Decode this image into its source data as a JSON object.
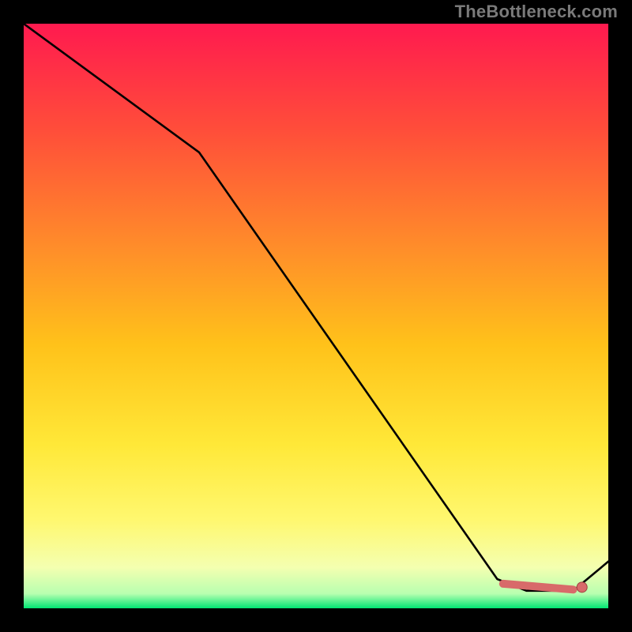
{
  "watermark": "TheBottleneck.com",
  "colors": {
    "black": "#000000",
    "watermark_grey": "#7a7a7a",
    "line": "#000000",
    "dot_fill": "#d86a6a",
    "dot_stroke": "#9e4040",
    "grad_top": "#ff1a4f",
    "grad_mid1": "#ff4d3a",
    "grad_mid2": "#ff8c2a",
    "grad_mid3": "#ffc21a",
    "grad_mid4": "#ffe838",
    "grad_mid5": "#fff870",
    "grad_mid6": "#f4ffb0",
    "grad_mid7": "#b8ffb0",
    "grad_bottom": "#00e673"
  },
  "chart_data": {
    "type": "line",
    "title": "",
    "xlabel": "",
    "ylabel": "",
    "xlim": [
      0,
      100
    ],
    "ylim": [
      0,
      100
    ],
    "series": [
      {
        "name": "curve",
        "x": [
          0,
          30,
          81,
          86,
          88,
          90,
          92,
          94,
          100
        ],
        "y": [
          100,
          78,
          5,
          3,
          3,
          3,
          3,
          3,
          8
        ]
      }
    ],
    "highlight_segment": {
      "name": "flat-bottom",
      "x": [
        82,
        94
      ],
      "y": [
        4.2,
        3.2
      ]
    },
    "highlight_point": {
      "name": "min-point",
      "x": 95.5,
      "y": 3.6
    },
    "grid": false,
    "legend": false
  }
}
